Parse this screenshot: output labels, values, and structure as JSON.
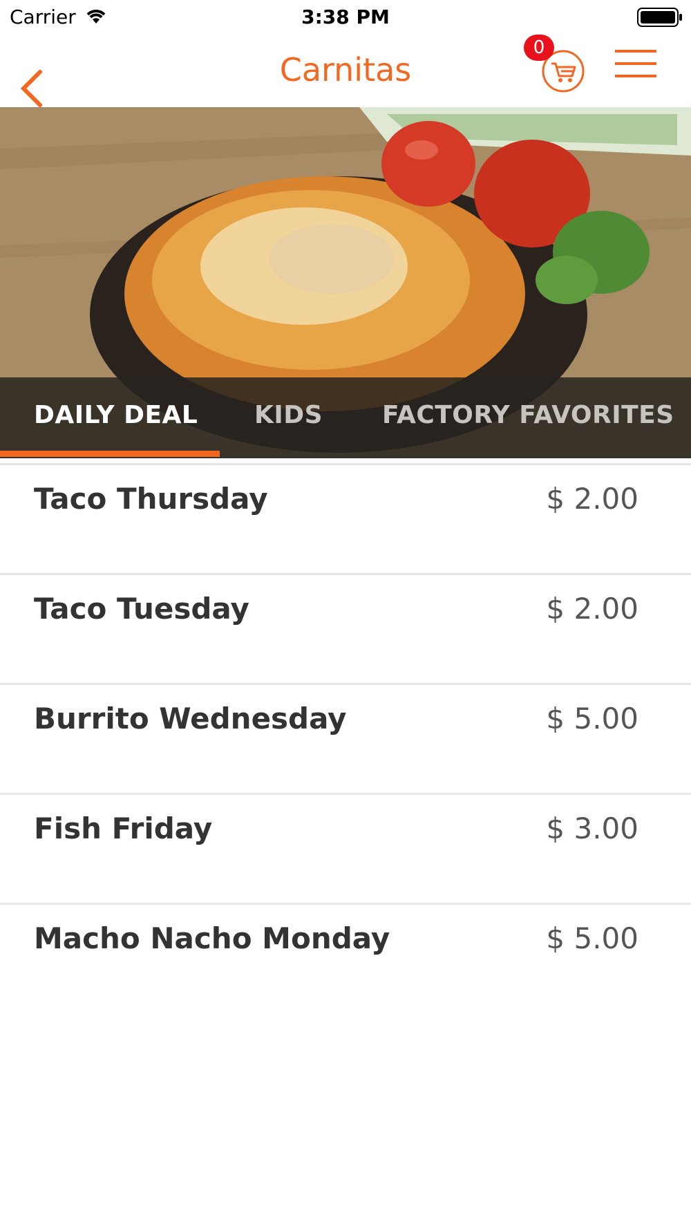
{
  "status_bar": {
    "carrier": "Carrier",
    "time": "3:38 PM"
  },
  "nav": {
    "title": "Carnitas",
    "cart_count": "0",
    "accent_color": "#f26722"
  },
  "tabs": [
    {
      "label": "DAILY DEAL",
      "active": true
    },
    {
      "label": "KIDS",
      "active": false
    },
    {
      "label": "FACTORY FAVORITES",
      "active": false
    }
  ],
  "items": [
    {
      "name": "Taco Thursday",
      "price": "$ 2.00"
    },
    {
      "name": "Taco Tuesday",
      "price": "$ 2.00"
    },
    {
      "name": "Burrito Wednesday",
      "price": "$ 5.00"
    },
    {
      "name": "Fish Friday",
      "price": "$ 3.00"
    },
    {
      "name": "Macho Nacho Monday",
      "price": "$ 5.00"
    }
  ],
  "icons": {
    "back": "chevron-left-icon",
    "cart": "cart-icon",
    "menu": "hamburger-menu-icon",
    "wifi": "wifi-icon",
    "battery": "battery-icon"
  }
}
